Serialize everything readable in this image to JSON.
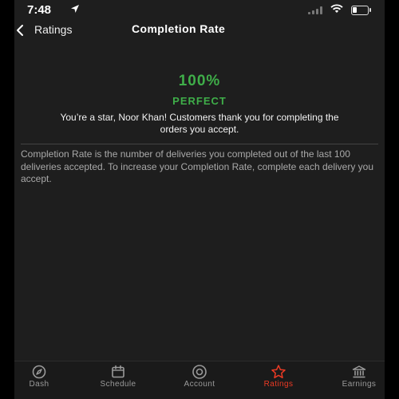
{
  "status_bar": {
    "time": "7:48",
    "battery_level": 0.3
  },
  "nav": {
    "back_label": "Ratings",
    "title": "Completion Rate"
  },
  "score": {
    "value": "100%",
    "label": "PERFECT",
    "message": "You’re a star, Noor Khan! Customers thank you for completing the orders you accept.",
    "color": "#3fae49"
  },
  "description": "Completion Rate is the number of deliveries you completed out of the last 100 deliveries accepted. To increase your Completion Rate, complete each delivery you accept.",
  "tab_bar": {
    "active_color": "#eb3a24",
    "tabs": [
      {
        "label": "Dash",
        "icon": "compass-icon"
      },
      {
        "label": "Schedule",
        "icon": "calendar-icon"
      },
      {
        "label": "Account",
        "icon": "account-icon"
      },
      {
        "label": "Ratings",
        "icon": "star-icon",
        "active": true
      },
      {
        "label": "Earnings",
        "icon": "bank-icon"
      }
    ]
  }
}
